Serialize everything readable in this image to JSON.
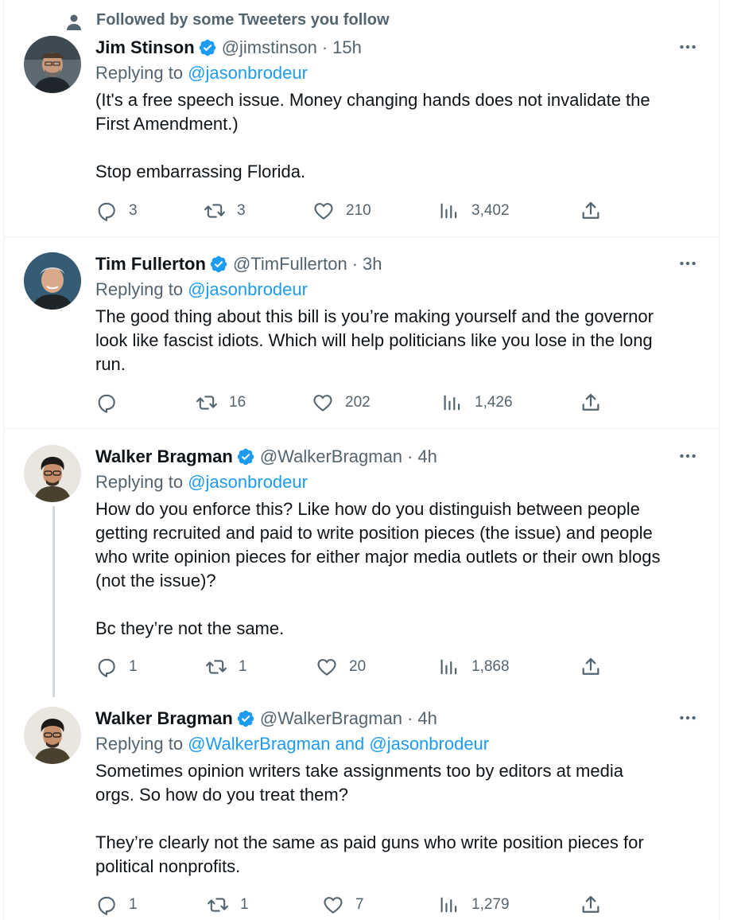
{
  "social_context": "Followed by some Tweeters you follow",
  "tweets": [
    {
      "name": "Jim Stinson",
      "handle": "@jimstinson",
      "time": "15h",
      "replying_prefix": "Replying to",
      "replying_to": "@jasonbrodeur",
      "text": "(It's a free speech issue. Money changing hands does not invalidate the\nFirst Amendment.)\n\nStop embarrassing Florida.",
      "replies": "3",
      "retweets": "3",
      "likes": "210",
      "views": "3,402"
    },
    {
      "name": "Tim Fullerton",
      "handle": "@TimFullerton",
      "time": "3h",
      "replying_prefix": "Replying to",
      "replying_to": "@jasonbrodeur",
      "text": "The good thing about this bill is you’re making yourself and the governor\nlook like fascist idiots. Which will help politicians like you lose in the long\nrun.",
      "replies": "",
      "retweets": "16",
      "likes": "202",
      "views": "1,426"
    },
    {
      "name": "Walker Bragman",
      "handle": "@WalkerBragman",
      "time": "4h",
      "replying_prefix": "Replying to",
      "replying_to": "@jasonbrodeur",
      "text": "How do you enforce this? Like how do you distinguish between people\ngetting recruited and paid to write position pieces (the issue) and people\nwho write opinion pieces for either major media outlets or their own blogs\n(not the issue)?\n\nBc they’re not the same.",
      "replies": "1",
      "retweets": "1",
      "likes": "20",
      "views": "1,868"
    },
    {
      "name": "Walker Bragman",
      "handle": "@WalkerBragman",
      "time": "4h",
      "replying_prefix": "Replying to",
      "replying_to": "@WalkerBragman and @jasonbrodeur",
      "text": "Sometimes opinion writers take assignments too by editors at media\norgs. So how do you treat them?\n\nThey’re clearly not the same as paid guns who write position pieces for\npolitical nonprofits.",
      "replies": "1",
      "retweets": "1",
      "likes": "7",
      "views": "1,279"
    }
  ],
  "icons": {
    "social": "person-icon",
    "verified": "verified-badge-icon",
    "more": "more-icon",
    "reply": "reply-icon",
    "retweet": "retweet-icon",
    "like": "like-icon",
    "views": "views-icon",
    "share": "share-icon"
  },
  "colors": {
    "accent": "#1d9bf0",
    "secondary_text": "#536471",
    "primary_text": "#0f1419",
    "divider": "#eff3f4"
  }
}
